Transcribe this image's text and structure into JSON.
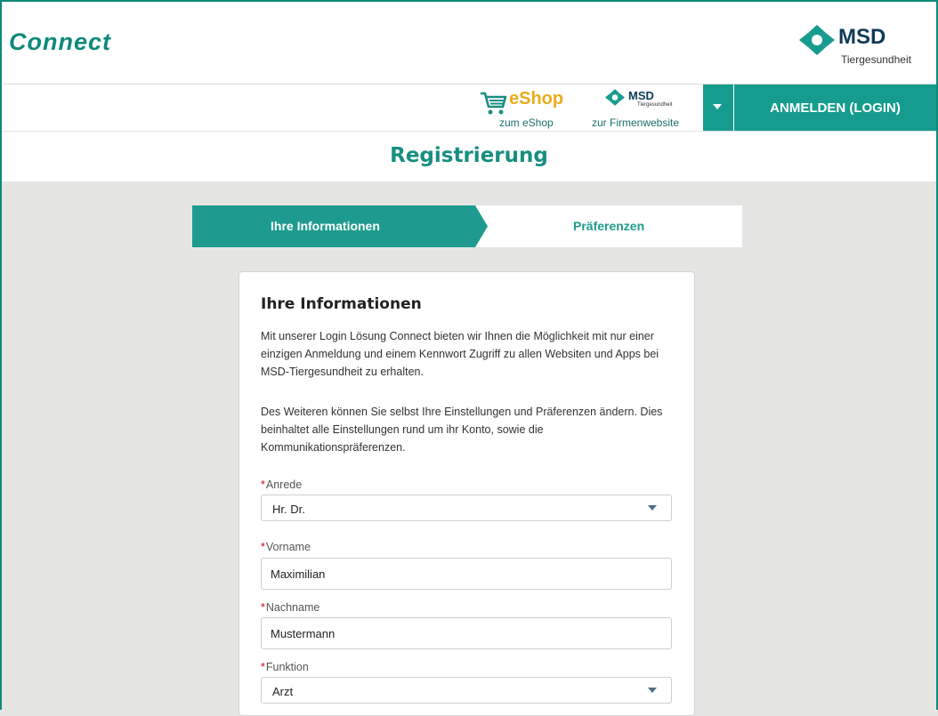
{
  "app": {
    "title": "Connect"
  },
  "brand": {
    "name": "MSD",
    "sub": "Tiergesundheit"
  },
  "nav": {
    "eshop_word": "eShop",
    "eshop_caption": "zum eShop",
    "site_name": "MSD",
    "site_sub": "Tiergesundheit",
    "site_caption": "zur Firmenwebsite",
    "login_label": "ANMELDEN (LOGIN)"
  },
  "page": {
    "title": "Registrierung"
  },
  "steps": [
    {
      "label": "Ihre Informationen",
      "active": true
    },
    {
      "label": "Präferenzen",
      "active": false
    }
  ],
  "form": {
    "heading": "Ihre Informationen",
    "intro1": "Mit unserer Login Lösung Connect bieten wir Ihnen die Möglichkeit mit nur einer einzigen Anmeldung und einem Kennwort Zugriff zu allen Websiten und Apps bei MSD-Tiergesundheit zu erhalten.",
    "intro2": "Des Weiteren können Sie selbst Ihre Einstellungen und Präferenzen ändern. Dies beinhaltet alle Einstellungen rund um ihr Konto, sowie die Kommunikationspräferenzen.",
    "required_mark": "*",
    "fields": {
      "anrede": {
        "label": "Anrede",
        "value": "Hr. Dr."
      },
      "vorname": {
        "label": "Vorname",
        "value": "Maximilian"
      },
      "nachname": {
        "label": "Nachname",
        "value": "Mustermann"
      },
      "funktion": {
        "label": "Funktion",
        "value": "Arzt"
      }
    }
  },
  "colors": {
    "teal": "#169c8e",
    "title_teal": "#168f81",
    "eshop_yellow": "#e8ad1b",
    "brand_navy": "#0f3b57",
    "required": "#d0021b"
  }
}
